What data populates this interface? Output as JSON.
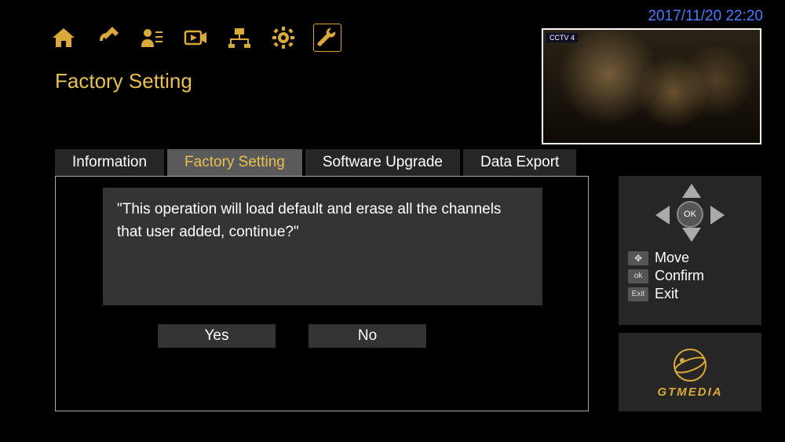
{
  "datetime": "2017/11/20  22:20",
  "page_title": "Factory Setting",
  "preview_channel": "CCTV 4",
  "tabs": [
    {
      "label": "Information",
      "active": false
    },
    {
      "label": "Factory Setting",
      "active": true
    },
    {
      "label": "Software Upgrade",
      "active": false
    },
    {
      "label": "Data Export",
      "active": false
    }
  ],
  "dialog": {
    "message": "\"This operation will load default and erase all the channels that user added, continue?\"",
    "yes": "Yes",
    "no": "No"
  },
  "legend": {
    "ok_label": "OK",
    "move": "Move",
    "confirm": "Confirm",
    "exit": "Exit",
    "key_ok": "ok",
    "key_exit": "Exit"
  },
  "logo_text": "GTMEDIA",
  "top_icons": [
    "home-icon",
    "satellite-icon",
    "user-icon",
    "video-icon",
    "network-icon",
    "gear-icon",
    "wrench-icon"
  ]
}
